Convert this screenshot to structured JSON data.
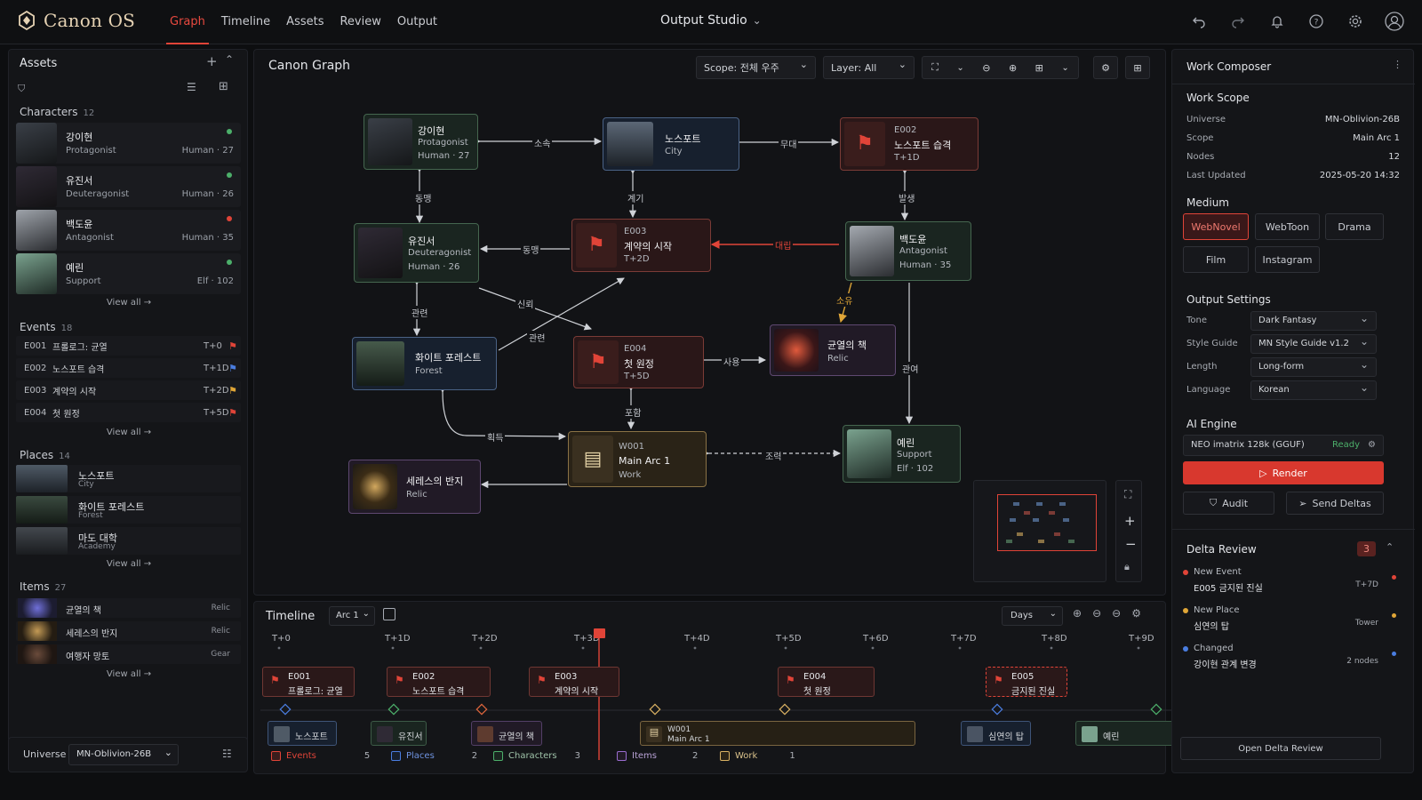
{
  "app": {
    "name": "Canon OS",
    "studio": "Output Studio"
  },
  "nav": {
    "tabs": [
      "Graph",
      "Timeline",
      "Assets",
      "Review",
      "Output"
    ]
  },
  "assets": {
    "title": "Assets",
    "characters_label": "Characters",
    "characters_count": "12",
    "characters": [
      {
        "name": "강이현",
        "role": "Protagonist",
        "meta": "Human · 27",
        "status": "#4caf6a"
      },
      {
        "name": "유진서",
        "role": "Deuteragonist",
        "meta": "Human · 26",
        "status": "#4caf6a"
      },
      {
        "name": "백도윤",
        "role": "Antagonist",
        "meta": "Human · 35",
        "status": "#e04438"
      },
      {
        "name": "예린",
        "role": "Support",
        "meta": "Elf · 102",
        "status": "#4caf6a"
      }
    ],
    "view_all": "View all →",
    "events_label": "Events",
    "events_count": "18",
    "events": [
      {
        "id": "E001",
        "title": "프롤로그: 균열",
        "time": "T+0",
        "flag": "#e04438"
      },
      {
        "id": "E002",
        "title": "노스포트 습격",
        "time": "T+1D",
        "flag": "#4a7de0"
      },
      {
        "id": "E003",
        "title": "계약의 시작",
        "time": "T+2D",
        "flag": "#e0a637"
      },
      {
        "id": "E004",
        "title": "첫 원정",
        "time": "T+5D",
        "flag": "#e04438"
      }
    ],
    "places_label": "Places",
    "places_count": "14",
    "places": [
      {
        "name": "노스포트",
        "sub": "City"
      },
      {
        "name": "화이트 포레스트",
        "sub": "Forest"
      },
      {
        "name": "마도 대학",
        "sub": "Academy"
      }
    ],
    "items_label": "Items",
    "items_count": "27",
    "items": [
      {
        "name": "균열의 책",
        "tag": "Relic"
      },
      {
        "name": "세레스의 반지",
        "tag": "Relic"
      },
      {
        "name": "여행자 망토",
        "tag": "Gear"
      }
    ]
  },
  "universe": {
    "label": "Universe",
    "value": "MN-Oblivion-26B"
  },
  "graph": {
    "title": "Canon Graph",
    "scope_label": "Scope:",
    "scope_value": "전체 우주",
    "layer_label": "Layer:",
    "layer_value": "All",
    "nodes": {
      "kang": {
        "name": "강이현",
        "l2": "Protagonist",
        "l3": "Human · 27"
      },
      "north": {
        "name": "노스포트",
        "l2": "City"
      },
      "e002": {
        "id": "E002",
        "name": "노스포트 습격",
        "time": "T+1D"
      },
      "yu": {
        "name": "유진서",
        "l2": "Deuteragonist",
        "l3": "Human · 26"
      },
      "e003": {
        "id": "E003",
        "name": "계약의 시작",
        "time": "T+2D"
      },
      "baek": {
        "name": "백도윤",
        "l2": "Antagonist",
        "l3": "Human · 35"
      },
      "forest": {
        "name": "화이트 포레스트",
        "l2": "Forest"
      },
      "e004": {
        "id": "E004",
        "name": "첫 원정",
        "time": "T+5D"
      },
      "book": {
        "name": "균열의 책",
        "l2": "Relic"
      },
      "w001": {
        "id": "W001",
        "name": "Main Arc 1",
        "l2": "Work"
      },
      "ring": {
        "name": "세레스의 반지",
        "l2": "Relic"
      },
      "yerin": {
        "name": "예린",
        "l2": "Support",
        "l3": "Elf · 102"
      }
    },
    "edges": {
      "belong": "소속",
      "stage": "무대",
      "ally1": "동맹",
      "trigger": "계기",
      "occur": "발생",
      "ally2": "동맹",
      "oppose": "대립",
      "trust": "신뢰",
      "related1": "관련",
      "related2": "관련",
      "own": "소유",
      "use": "사용",
      "include": "포함",
      "interest": "관여",
      "acquire": "획득",
      "assist": "조력"
    }
  },
  "timeline": {
    "title": "Timeline",
    "arc": "Arc 1",
    "unit": "Days",
    "ticks": [
      "T+0",
      "T+1D",
      "T+2D",
      "T+3D",
      "T+4D",
      "T+5D",
      "T+6D",
      "T+7D",
      "T+8D",
      "T+9D"
    ],
    "events": [
      {
        "id": "E001",
        "title": "프롤로그: 균열"
      },
      {
        "id": "E002",
        "title": "노스포트 습격"
      },
      {
        "id": "E003",
        "title": "계약의 시작"
      },
      {
        "id": "E004",
        "title": "첫 원정"
      },
      {
        "id": "E005",
        "title": "금지된 진실"
      }
    ],
    "rows": [
      "노스포트",
      "유진서",
      "균열의 책",
      "W001",
      "Main Arc 1",
      "심연의 탑",
      "예린"
    ],
    "legend": [
      {
        "label": "Events",
        "count": "5",
        "color": "#e04438"
      },
      {
        "label": "Places",
        "count": "2",
        "color": "#4a7de0"
      },
      {
        "label": "Characters",
        "count": "3",
        "color": "#4caf6a"
      },
      {
        "label": "Items",
        "count": "2",
        "color": "#9a6cd0"
      },
      {
        "label": "Work",
        "count": "1",
        "color": "#d8b062"
      }
    ]
  },
  "composer": {
    "title": "Work Composer",
    "scope_title": "Work Scope",
    "scope": [
      {
        "k": "Universe",
        "v": "MN-Oblivion-26B"
      },
      {
        "k": "Scope",
        "v": "Main Arc 1"
      },
      {
        "k": "Nodes",
        "v": "12"
      },
      {
        "k": "Last Updated",
        "v": "2025-05-20 14:32"
      }
    ],
    "medium_title": "Medium",
    "medium": [
      "WebNovel",
      "WebToon",
      "Drama",
      "Film",
      "Instagram"
    ],
    "output_title": "Output Settings",
    "settings": [
      {
        "k": "Tone",
        "v": "Dark Fantasy"
      },
      {
        "k": "Style Guide",
        "v": "MN Style Guide v1.2"
      },
      {
        "k": "Length",
        "v": "Long-form"
      },
      {
        "k": "Language",
        "v": "Korean"
      }
    ],
    "ai_title": "AI Engine",
    "engine": "NEO imatrix 128k (GGUF)",
    "engine_status": "Ready",
    "render": "Render",
    "audit": "Audit",
    "send": "Send Deltas",
    "delta_title": "Delta Review",
    "delta_count": "3",
    "deltas": [
      {
        "k": "New Event",
        "v": "E005  금지된 진실",
        "r": "T+7D",
        "color": "#e04438"
      },
      {
        "k": "New Place",
        "v": "심연의 탑",
        "r": "Tower",
        "color": "#e0a637"
      },
      {
        "k": "Changed",
        "v": "강이현 관계 변경",
        "r": "2 nodes",
        "color": "#4a7de0"
      }
    ],
    "open_delta": "Open Delta Review"
  }
}
